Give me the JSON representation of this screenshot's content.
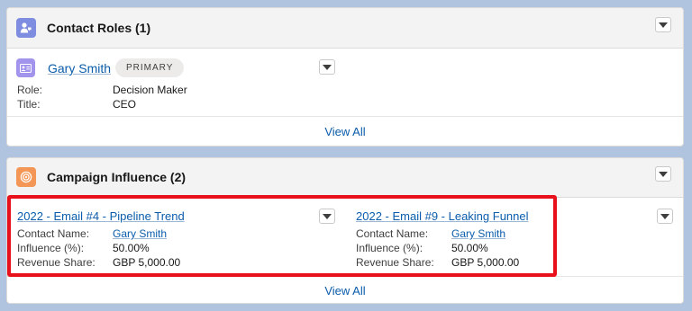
{
  "contact_roles": {
    "title": "Contact Roles (1)",
    "contact": {
      "name": "Gary Smith",
      "badge": "PRIMARY",
      "role_label": "Role:",
      "role_value": "Decision Maker",
      "title_label": "Title:",
      "title_value": "CEO"
    },
    "view_all": "View All"
  },
  "campaign_influence": {
    "title": "Campaign Influence (2)",
    "items": [
      {
        "name": "2022 - Email #4 - Pipeline Trend",
        "contact_label": "Contact Name:",
        "contact_value": "Gary Smith",
        "influence_label": "Influence (%):",
        "influence_value": "50.00%",
        "revenue_label": "Revenue Share:",
        "revenue_value": "GBP 5,000.00"
      },
      {
        "name": "2022 - Email #9 - Leaking Funnel",
        "contact_label": "Contact Name:",
        "contact_value": "Gary Smith",
        "influence_label": "Influence (%):",
        "influence_value": "50.00%",
        "revenue_label": "Revenue Share:",
        "revenue_value": "GBP 5,000.00"
      }
    ],
    "view_all": "View All"
  },
  "colors": {
    "contact_roles_icon": "#7f8de1",
    "contact_icon": "#a094ed",
    "campaign_icon": "#f49756",
    "highlight": "#e8101a",
    "link": "#0b5cab"
  },
  "icons": {
    "contact_roles": "contact-roles-icon",
    "contact": "contact-card-icon",
    "campaign": "campaign-target-icon",
    "menu": "chevron-down-icon"
  }
}
